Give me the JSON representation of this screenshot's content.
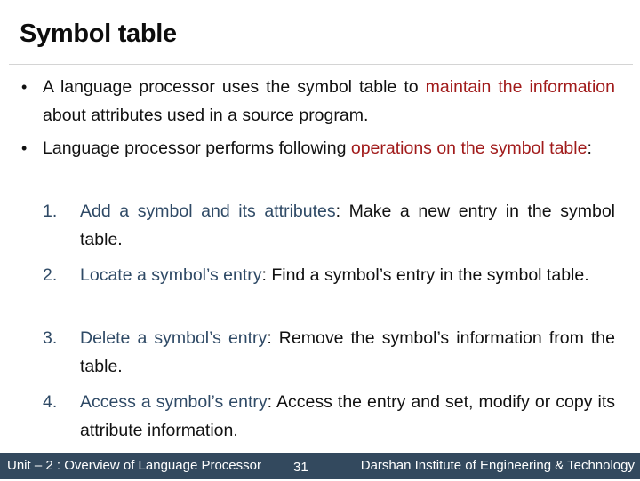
{
  "slide": {
    "title": "Symbol table"
  },
  "bullets": [
    {
      "marker": "•",
      "segments": [
        {
          "text": "A language processor uses the symbol table to ",
          "style": "plain"
        },
        {
          "text": "maintain the information",
          "style": "red"
        },
        {
          "text": " about attributes used in a source program.",
          "style": "plain"
        }
      ]
    },
    {
      "marker": "•",
      "segments": [
        {
          "text": "Language processor performs following ",
          "style": "plain"
        },
        {
          "text": "operations on the symbol table",
          "style": "red"
        },
        {
          "text": ":",
          "style": "plain"
        }
      ]
    }
  ],
  "operations": [
    {
      "number": "1.",
      "term": "Add a symbol and its attributes",
      "description": ": Make a new entry in the symbol table."
    },
    {
      "number": "2.",
      "term": "Locate a symbol’s entry",
      "description": ": Find a symbol’s entry in the symbol table."
    },
    {
      "number": "3.",
      "term": "Delete a symbol’s entry",
      "description": ": Remove the symbol’s information from the table."
    },
    {
      "number": "4.",
      "term": "Access a symbol’s entry",
      "description": ": Access the entry and set, modify or copy its attribute information."
    }
  ],
  "footer": {
    "unit": "Unit – 2 : Overview of Language Processor",
    "page_number": "31",
    "institute": "Darshan Institute of Engineering & Technology"
  },
  "colors": {
    "highlight_red": "#a11b1b",
    "term_blue": "#2f4a66",
    "footer_bg": "#33495e",
    "divider": "#d4d4d4"
  }
}
